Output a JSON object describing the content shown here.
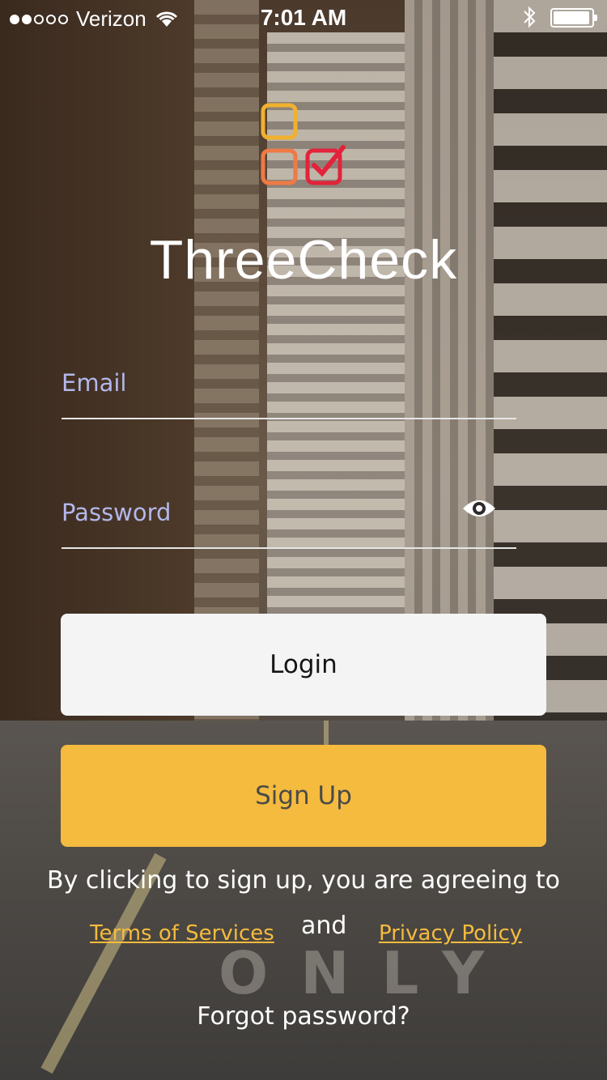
{
  "status_bar": {
    "carrier": "Verizon",
    "time": "7:01 AM"
  },
  "app": {
    "title": "ThreeCheck"
  },
  "form": {
    "email_placeholder": "Email",
    "password_placeholder": "Password",
    "login_label": "Login",
    "signup_label": "Sign Up"
  },
  "legal": {
    "agree_text": "By clicking to sign up, you are agreeing to",
    "terms_label": "Terms of Services",
    "and_text": "and",
    "privacy_label": "Privacy Policy"
  },
  "footer": {
    "forgot_label": "Forgot password?"
  },
  "colors": {
    "accent": "#f5bb3e",
    "logo_top": "#f1b12f",
    "logo_left": "#ee7a45",
    "logo_check": "#e3233b"
  }
}
